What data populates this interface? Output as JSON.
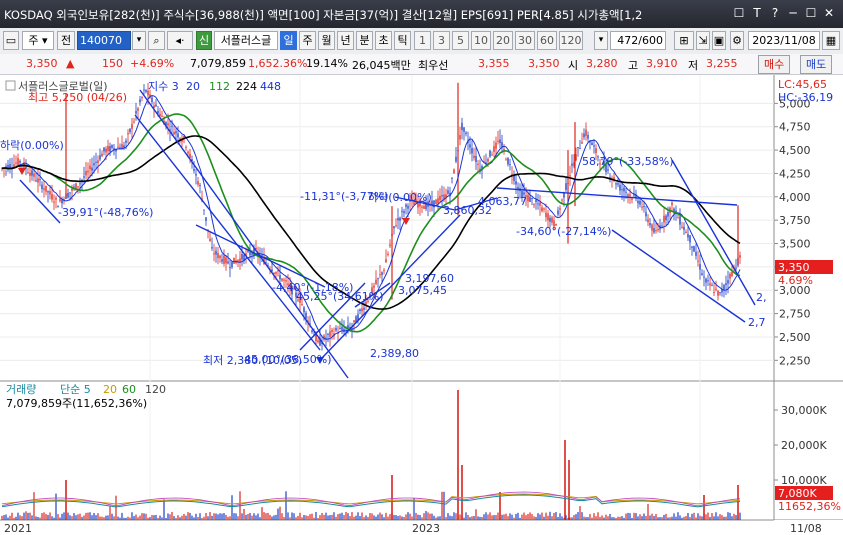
{
  "window": {
    "title": "KOSDAQ 외국인보유[282(천)] 주식수[36,988(천)] 액면[100] 자본금[37(억)] 결산[12월] EPS[691] PER[4.85] 시가총액[1,2",
    "buttons": [
      "☐",
      "T",
      "?",
      "─",
      "☐",
      "✕"
    ]
  },
  "toolbar": {
    "code_label": "주",
    "code_prefix": "전",
    "code_value": "140070",
    "search_icon": "search-icon",
    "back_icon": "back-icon",
    "new_badge": "신",
    "stock_name": "서플러스글",
    "periods": [
      "일",
      "주",
      "월",
      "년",
      "분",
      "초",
      "틱"
    ],
    "active_period": "일",
    "numbers": [
      "1",
      "3",
      "5",
      "10",
      "20",
      "30",
      "60",
      "120"
    ],
    "count": "472",
    "count_total": "/600",
    "date": "2023/11/08"
  },
  "quote": {
    "price": "3,350",
    "arrow": "▲",
    "change": "150",
    "change_pct": "+4.69%",
    "volume": "7,079,859",
    "volume_pct": "1,652.36%",
    "turnover": "19.14%",
    "amount": "26,045백만",
    "best_ask_label": "최우선",
    "best_ask": "3,355",
    "best_bid": "3,350",
    "open_label": "시",
    "open": "3,280",
    "high_label": "고",
    "high": "3,910",
    "low_label": "저",
    "low": "3,255",
    "buy_label": "매수",
    "sell_label": "매도"
  },
  "price_panel": {
    "legend_prefix": "서플러스글로벌(일)",
    "legend_ma": "지수 3",
    "legend_periods": [
      "20",
      "112",
      "224",
      "448"
    ],
    "lc": "LC:45,65",
    "hc": "HC:-36,19",
    "current_price": "3,350",
    "current_pct": "4.69%",
    "annotations": {
      "high": "최고 5,250 (04/26)",
      "low": "최저 2,380 (10/05)",
      "left_drop": "하락(0.00%)",
      "a1": "-39,91°(-48,76%)",
      "a2": "-11,31°(-3,77%)",
      "a3": "하락(0.00%)",
      "a4": "4,063,77",
      "a5": "3,860,32",
      "a6": "-34,60°(-27,14%)",
      "a7": "58,79°(-33,58%)",
      "a8": "3,197,60",
      "a9": "3,075,45",
      "a10": "-4,40°(-1,18%)",
      "a11": "45,25°(34,61%)",
      "a12": "2,389,80",
      "a13": "45,00°(38,50%)",
      "a14": "2,7",
      "a15": "2,"
    }
  },
  "volume_panel": {
    "legend_title": "거래량",
    "legend_ma": "단순 5",
    "legend_periods": [
      "20",
      "60",
      "120"
    ],
    "info": "7,079,859주(11,652,36%)",
    "current_volume": "7,080K",
    "current_pct": "11652,36%"
  },
  "axis": {
    "x_labels": [
      "2021",
      "2023"
    ],
    "date_end": "11/08",
    "price_ticks": [
      "5,000",
      "4,750",
      "4,500",
      "4,250",
      "4,000",
      "3,750",
      "3,500",
      "3,250",
      "3,000",
      "2,750",
      "2,500",
      "2,250"
    ],
    "volume_ticks": [
      "30,000K",
      "20,000K",
      "10,000K"
    ]
  },
  "colors": {
    "up": "#e0251c",
    "down": "#1c3fc7",
    "ma20": "#1d8f1d",
    "ma112": "#000000",
    "trend": "#1a33d6",
    "volume_up": "#d8241e"
  }
}
